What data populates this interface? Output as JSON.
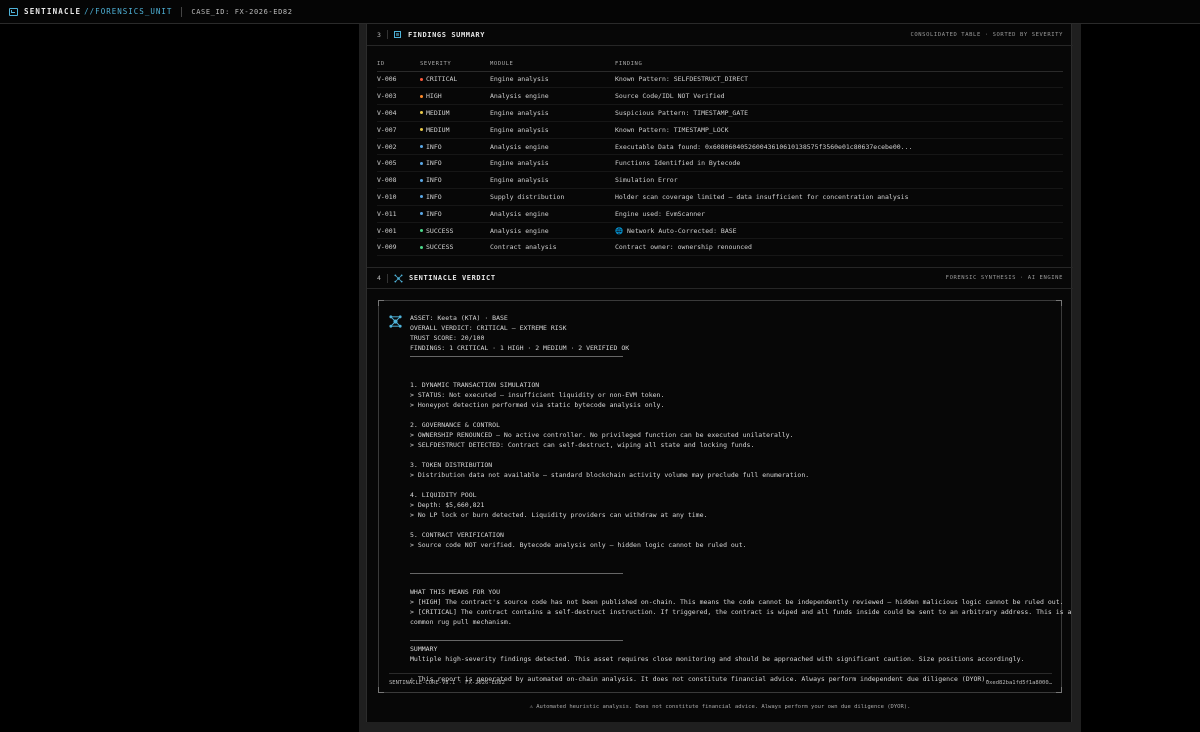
{
  "header": {
    "brand": "SENTINACLE",
    "unit": "//FORENSICS_UNIT",
    "case_id": "CASE_ID: FX-2026-ED82"
  },
  "findings": {
    "num": "3",
    "title": "FINDINGS SUMMARY",
    "subtitle": "CONSOLIDATED TABLE · SORTED BY SEVERITY",
    "columns": [
      "ID",
      "SEVERITY",
      "MODULE",
      "FINDING"
    ],
    "rows": [
      {
        "id": "V-006",
        "severity": "CRITICAL",
        "module": "Engine analysis",
        "finding": "Known Pattern: SELFDESTRUCT_DIRECT",
        "color": "#ff5a3c"
      },
      {
        "id": "V-003",
        "severity": "HIGH",
        "module": "Analysis engine",
        "finding": "Source Code/IDL NOT Verified",
        "color": "#ff8a2a"
      },
      {
        "id": "V-004",
        "severity": "MEDIUM",
        "module": "Engine analysis",
        "finding": "Suspicious Pattern: TIMESTAMP_GATE",
        "color": "#e8c84a"
      },
      {
        "id": "V-007",
        "severity": "MEDIUM",
        "module": "Engine analysis",
        "finding": "Known Pattern: TIMESTAMP_LOCK",
        "color": "#e8c84a"
      },
      {
        "id": "V-002",
        "severity": "INFO",
        "module": "Analysis engine",
        "finding": "Executable Data found: 0x608060405260043610610138575f3560e01c80637ecebe00...",
        "color": "#5aa8e6"
      },
      {
        "id": "V-005",
        "severity": "INFO",
        "module": "Engine analysis",
        "finding": "Functions Identified in Bytecode",
        "color": "#5aa8e6"
      },
      {
        "id": "V-008",
        "severity": "INFO",
        "module": "Engine analysis",
        "finding": "Simulation Error",
        "color": "#5aa8e6"
      },
      {
        "id": "V-010",
        "severity": "INFO",
        "module": "Supply distribution",
        "finding": "Holder scan coverage limited — data insufficient for concentration analysis",
        "color": "#5aa8e6"
      },
      {
        "id": "V-011",
        "severity": "INFO",
        "module": "Analysis engine",
        "finding": "Engine used: EvmScanner",
        "color": "#5aa8e6"
      },
      {
        "id": "V-001",
        "severity": "SUCCESS",
        "module": "Analysis engine",
        "finding": "🌐 Network Auto-Corrected: BASE",
        "color": "#4cd98a"
      },
      {
        "id": "V-009",
        "severity": "SUCCESS",
        "module": "Contract analysis",
        "finding": "Contract owner: ownership renounced",
        "color": "#4cd98a"
      }
    ]
  },
  "verdict": {
    "num": "4",
    "title": "SENTINACLE VERDICT",
    "subtitle": "FORENSIC SYNTHESIS · AI ENGINE",
    "header_lines": [
      "ASSET: Keeta (KTA) · BASE",
      "OVERALL VERDICT: CRITICAL — EXTREME RISK",
      "TRUST SCORE: 20/100",
      "FINDINGS: 1 CRITICAL · 1 HIGH · 2 MEDIUM · 2 VERIFIED OK"
    ],
    "sections": [
      {
        "title": "1. DYNAMIC TRANSACTION SIMULATION",
        "lines": [
          "> STATUS: Not executed — insufficient liquidity or non-EVM token.",
          "> Honeypot detection performed via static bytecode analysis only."
        ]
      },
      {
        "title": "2. GOVERNANCE & CONTROL",
        "lines": [
          "> OWNERSHIP RENOUNCED — No active controller. No privileged function can be executed unilaterally.",
          "> SELFDESTRUCT DETECTED: Contract can self-destruct, wiping all state and locking funds."
        ]
      },
      {
        "title": "3. TOKEN DISTRIBUTION",
        "lines": [
          "> Distribution data not available — standard blockchain activity volume may preclude full enumeration."
        ]
      },
      {
        "title": "4. LIQUIDITY POOL",
        "lines": [
          "> Depth: $5,660,821",
          "> No LP lock or burn detected. Liquidity providers can withdraw at any time."
        ]
      },
      {
        "title": "5. CONTRACT VERIFICATION",
        "lines": [
          "> Source code NOT verified. Bytecode analysis only — hidden logic cannot be ruled out."
        ]
      }
    ],
    "means_title": "WHAT THIS MEANS FOR YOU",
    "means_lines": [
      "> [HIGH] The contract's source code has not been published on-chain. This means the code cannot be independently reviewed — hidden malicious logic cannot be ruled out.",
      "> [CRITICAL] The contract contains a self-destruct instruction. If triggered, the contract is wiped and all funds inside could be sent to an arbitrary address. This is a",
      "common rug pull mechanism."
    ],
    "summary_title": "SUMMARY",
    "summary_line": "Multiple high-severity findings detected. This asset requires close monitoring and should be approached with significant caution. Size positions accordingly.",
    "report_note": "⚠ This report is generated by automated on-chain analysis. It does not constitute financial advice. Always perform independent due diligence (DYOR).",
    "footer_left": "SENTINACLE-CORE-V3.1 · FX-2026-ED82",
    "footer_right": "0xed82ba1fd5f1a8000…"
  },
  "disclaimer": "⚠ Automated heuristic analysis. Does not constitute financial advice. Always perform your own due diligence (DYOR).",
  "colors": {
    "accent": "#4fb3d9"
  }
}
